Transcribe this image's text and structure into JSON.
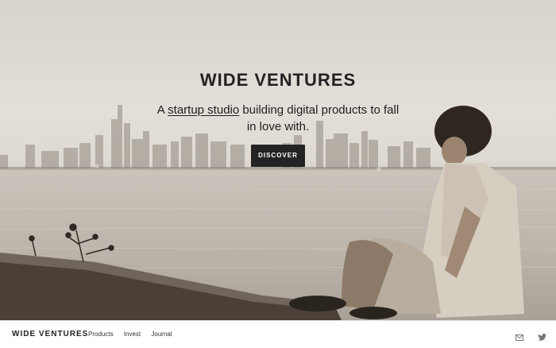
{
  "hero": {
    "title": "WIDE VENTURES",
    "tagline_prefix": "A ",
    "tagline_link": "startup studio",
    "tagline_suffix": " building digital products to fall in love with.",
    "cta_label": "DISCOVER"
  },
  "nav": {
    "brand": "WIDE VENTURES",
    "links": [
      "Products",
      "Invest",
      "Journal"
    ],
    "icons": [
      "mail-icon",
      "twitter-icon"
    ]
  },
  "colors": {
    "text": "#222222",
    "button_bg": "#232323",
    "button_text": "#ffffff"
  }
}
